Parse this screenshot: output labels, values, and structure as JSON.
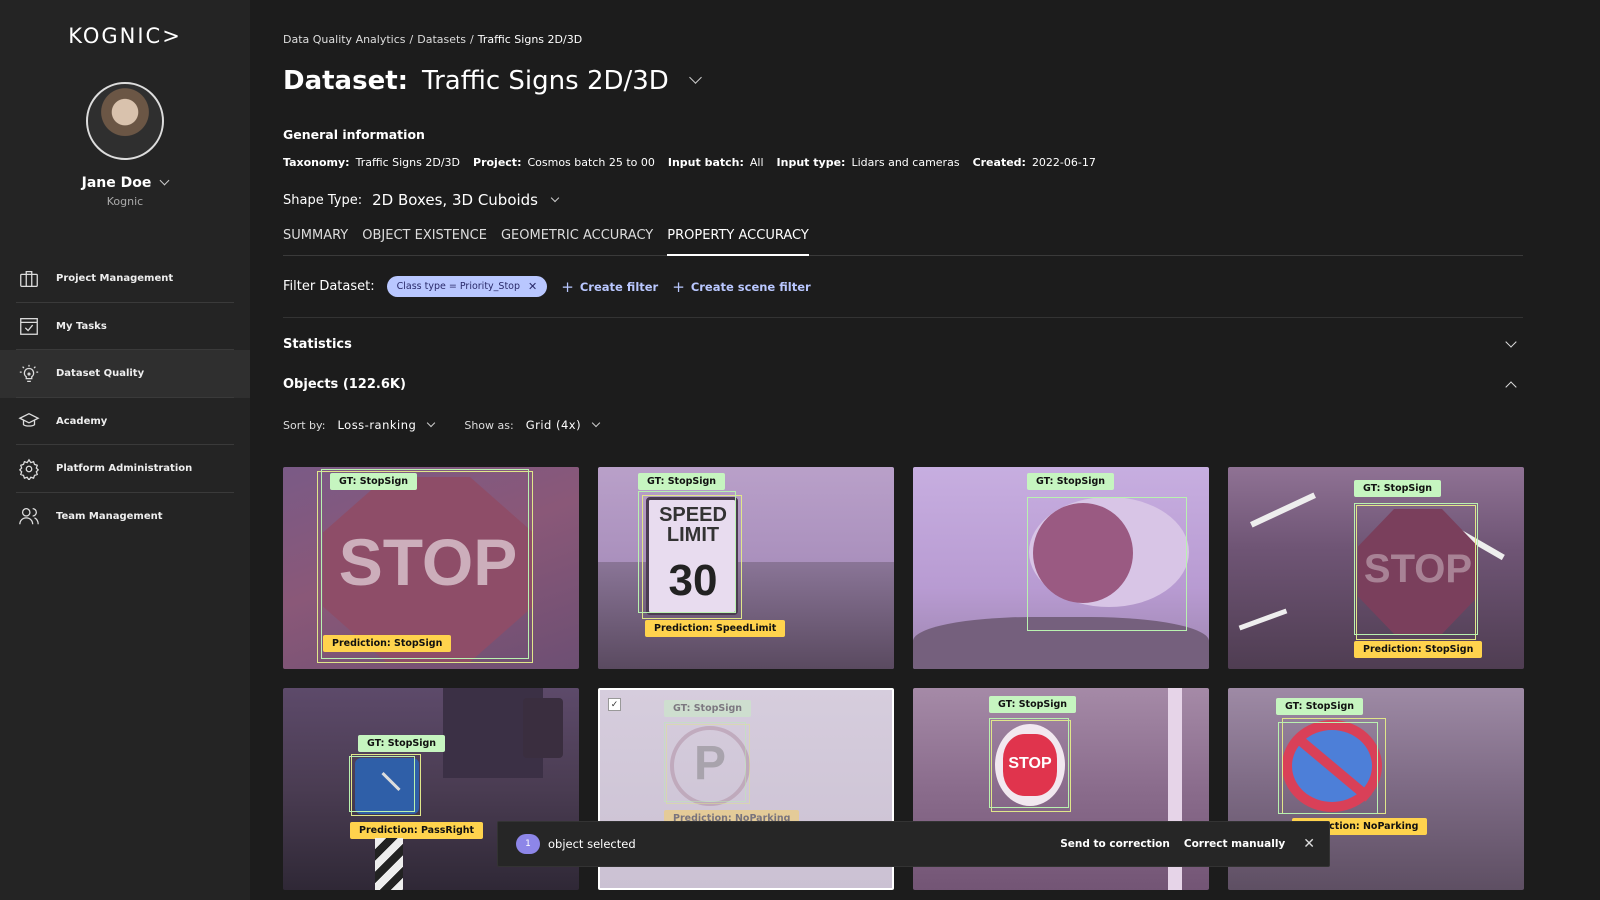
{
  "brand": {
    "logo": "KOGNIC>"
  },
  "user": {
    "name": "Jane Doe",
    "org": "Kognic"
  },
  "nav": [
    {
      "label": "Project Management",
      "icon": "briefcase-icon"
    },
    {
      "label": "My Tasks",
      "icon": "checkbox-icon"
    },
    {
      "label": "Dataset Quality",
      "icon": "lightbulb-icon",
      "active": true
    },
    {
      "label": "Academy",
      "icon": "graduation-cap-icon"
    },
    {
      "label": "Platform Administration",
      "icon": "gear-icon"
    },
    {
      "label": "Team Management",
      "icon": "users-icon"
    }
  ],
  "breadcrumb": [
    "Data Quality Analytics",
    "Datasets",
    "Traffic Signs 2D/3D"
  ],
  "breadcrumb_sep": "/",
  "title": {
    "prefix": "Dataset:",
    "name": "Traffic Signs 2D/3D"
  },
  "general": {
    "heading": "General information",
    "fields": [
      {
        "key": "Taxonomy:",
        "value": "Traffic Signs 2D/3D"
      },
      {
        "key": "Project:",
        "value": "Cosmos batch 25 to 00"
      },
      {
        "key": "Input batch:",
        "value": "All"
      },
      {
        "key": "Input type:",
        "value": "Lidars and cameras"
      },
      {
        "key": "Created:",
        "value": "2022-06-17"
      }
    ]
  },
  "shape_type": {
    "label": "Shape Type:",
    "value": "2D Boxes, 3D Cuboids"
  },
  "tabs": [
    "SUMMARY",
    "OBJECT EXISTENCE",
    "GEOMETRIC ACCURACY",
    "PROPERTY ACCURACY"
  ],
  "active_tab": "PROPERTY ACCURACY",
  "filter": {
    "label": "Filter Dataset:",
    "chip": "Class type = Priority_Stop",
    "create_filter": "Create filter",
    "create_scene_filter": "Create scene filter"
  },
  "sections": {
    "statistics": "Statistics",
    "objects": "Objects (122.6K)"
  },
  "sort": {
    "label": "Sort by:",
    "value": "Loss-ranking"
  },
  "show": {
    "label": "Show as:",
    "value": "Grid (4x)"
  },
  "cards": [
    {
      "gt": "GT: StopSign",
      "pred": "Prediction: StopSign",
      "sign": "STOP"
    },
    {
      "gt": "GT: StopSign",
      "pred": "Prediction: SpeedLimit",
      "sign": "SPEED LIMIT 30"
    },
    {
      "gt": "GT: StopSign",
      "pred": "",
      "sign": ""
    },
    {
      "gt": "GT: StopSign",
      "pred": "Prediction: StopSign",
      "sign": "STOP"
    },
    {
      "gt": "GT: StopSign",
      "pred": "Prediction: PassRight",
      "sign": ""
    },
    {
      "gt": "GT: StopSign",
      "pred": "Prediction: NoParking",
      "sign": "P",
      "selected": true
    },
    {
      "gt": "GT: StopSign",
      "pred": "",
      "sign": "STOP"
    },
    {
      "gt": "GT: StopSign",
      "pred": "Prediction: NoParking",
      "sign": ""
    }
  ],
  "selection": {
    "count": "1",
    "text": "object selected",
    "send": "Send to correction",
    "correct": "Correct manually"
  },
  "colors": {
    "sidebar": "#242424",
    "background": "#1c1c1c",
    "chip": "#b9c7ff",
    "gt_label": "#c6f5c0",
    "pred_label": "#ffd34d",
    "accent": "#8d86e8"
  }
}
